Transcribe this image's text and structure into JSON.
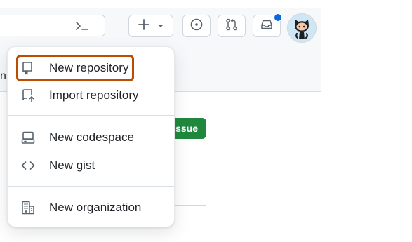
{
  "colors": {
    "accent": "#0969da",
    "focus_outline": "#bc4c00",
    "primary_button": "#1f883d",
    "text": "#1f2328",
    "icon": "#59636e",
    "border": "#d0d7de"
  },
  "header": {
    "search": {
      "command_palette_icon": "terminal-prompt-icon"
    },
    "create_button": {
      "icon": "plus-icon",
      "caret_icon": "triangle-down-icon"
    },
    "issues_button": {
      "icon": "issue-opened-icon"
    },
    "pulls_button": {
      "icon": "git-pull-request-icon"
    },
    "inbox_button": {
      "icon": "inbox-icon",
      "has_unread": true
    },
    "avatar": {
      "icon": "octocat-avatar"
    }
  },
  "background": {
    "partial_text": "n",
    "issue_button_label": "ssue"
  },
  "create_menu": {
    "items": [
      {
        "label": "New repository",
        "icon": "repo-icon",
        "focused": true
      },
      {
        "label": "Import repository",
        "icon": "repo-push-icon"
      },
      {
        "label": "New codespace",
        "icon": "codespaces-icon"
      },
      {
        "label": "New gist",
        "icon": "code-icon"
      },
      {
        "label": "New organization",
        "icon": "organization-icon"
      }
    ]
  }
}
